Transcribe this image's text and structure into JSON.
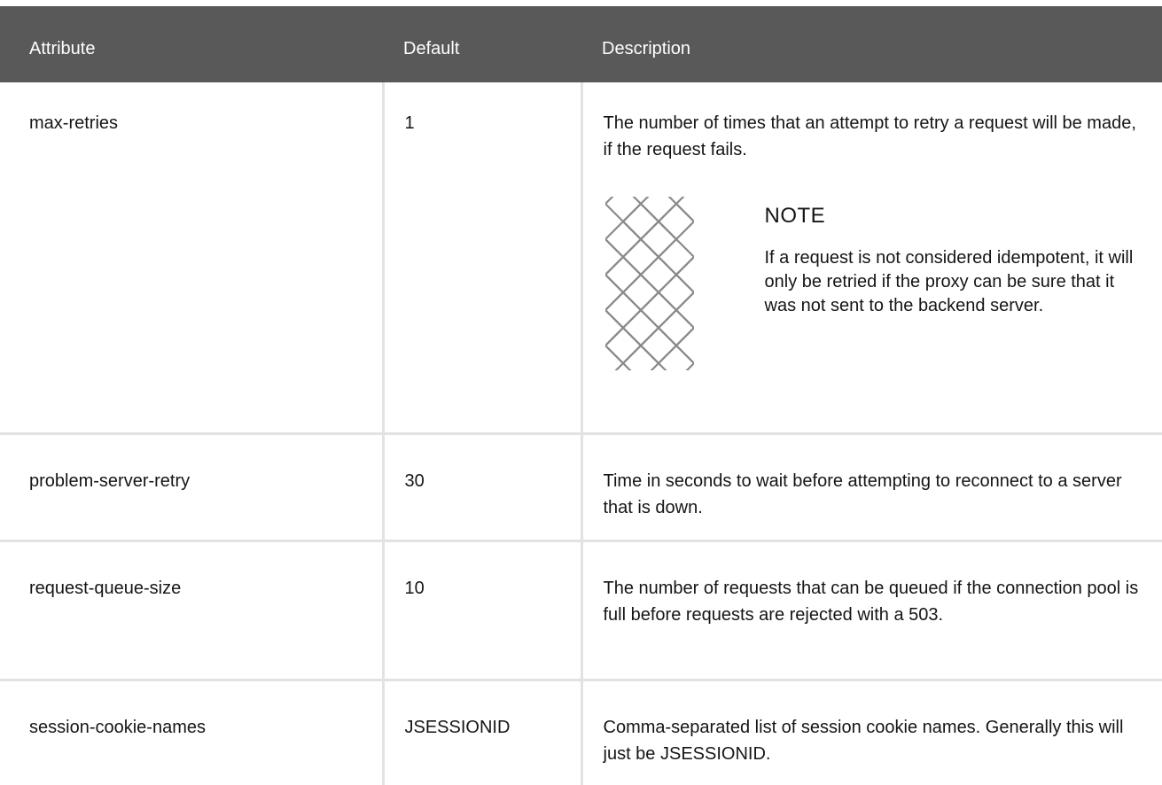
{
  "table": {
    "headers": {
      "attribute": "Attribute",
      "default": "Default",
      "description": "Description"
    },
    "rows": [
      {
        "attribute": "max-retries",
        "default": "1",
        "description": "The number of times that an attempt to retry a request will be made, if the request fails.",
        "note": {
          "icon": "note-pattern-icon",
          "title": "NOTE",
          "text": "If a request is not considered idempotent, it will only be retried if the proxy can be sure that it was not sent to the backend server."
        }
      },
      {
        "attribute": "problem-server-retry",
        "default": "30",
        "description": "Time in seconds to wait before attempting to reconnect to a server that is down."
      },
      {
        "attribute": "request-queue-size",
        "default": "10",
        "description": "The number of requests that can be queued if the connection pool is full before requests are rejected with a 503."
      },
      {
        "attribute": "session-cookie-names",
        "default": "JSESSIONID",
        "description": "Comma-separated list of session cookie names. Generally this will just be JSESSIONID."
      }
    ]
  },
  "colors": {
    "header_bg": "#595959",
    "header_text": "#ffffff",
    "border": "#e2e2e2",
    "text": "#151515"
  }
}
